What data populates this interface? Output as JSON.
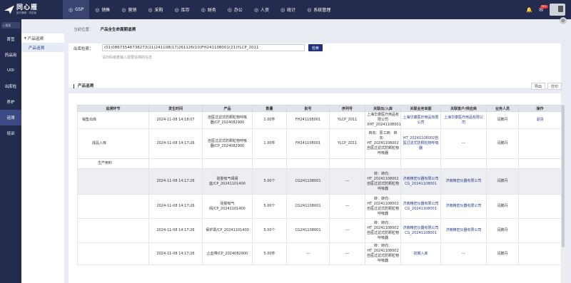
{
  "logo": {
    "title": "同心雁",
    "subtitle": "医疗器械 · 供应链"
  },
  "nav": [
    {
      "label": "GSP",
      "icon": "gsp-icon",
      "active": true
    },
    {
      "label": "销售",
      "icon": "sales-icon"
    },
    {
      "label": "营销",
      "icon": "marketing-icon"
    },
    {
      "label": "采购",
      "icon": "purchase-icon"
    },
    {
      "label": "库存",
      "icon": "inventory-icon"
    },
    {
      "label": "财务",
      "icon": "finance-icon"
    },
    {
      "label": "办公",
      "icon": "office-icon"
    },
    {
      "label": "人资",
      "icon": "hr-icon"
    },
    {
      "label": "统计",
      "icon": "stats-icon"
    },
    {
      "label": "系统管理",
      "icon": "system-icon"
    }
  ],
  "notification_badge": "99+",
  "sidebar": {
    "search_placeholder": "搜索",
    "items": [
      {
        "label": "首营"
      },
      {
        "label": "药品用"
      },
      {
        "label": "UDI"
      },
      {
        "label": "出库检"
      },
      {
        "label": "养护"
      },
      {
        "label": "追溯",
        "active": true
      },
      {
        "label": "培训"
      }
    ]
  },
  "subnav": {
    "header": "产品追溯",
    "item": "产品追溯"
  },
  "breadcrumb": {
    "prefix": "当前位置：",
    "current": "产品全生命周期追溯"
  },
  "scan": {
    "label": "出库检索：",
    "value": "(01)08673546738273(11)241108(17)261126(10)FH241108001(21)YLCP_2011",
    "button": "检索",
    "hint": "请扫码或者输入需要追溯的信息"
  },
  "trace": {
    "title": "产品追溯",
    "export": "导出",
    "print": "打印"
  },
  "columns": [
    "追溯环节",
    "发生时间",
    "产品",
    "数量",
    "批号",
    "序列号",
    "关联出/入库",
    "关联业务单据",
    "关联客户/供应商",
    "业务人员",
    "操作"
  ],
  "rows": [
    {
      "stage": "销售出库",
      "time": "2024-11-08 14:18:07",
      "product": "自医过滤式防颗粒物呼吸器/CP_2024082900",
      "qty": "1.00件",
      "batch": "FH241108001",
      "serial": "YLCP_2011",
      "io": "上海华康医疗用品有限公司 XHT_20241108001",
      "doc": "上海华康医疗用品有限公司",
      "partner": "上海华康医疗用品有限公司",
      "staff": "闫鹏丹",
      "action": "退货"
    },
    {
      "stage": "成品入库",
      "time": "2024-11-08 14:17:26",
      "product": "自医过滤式防颗粒物呼吸器/CP_2024082900",
      "qty": "1.00件",
      "batch": "FH241108001",
      "serial": "YLCP_2011",
      "io": "转向：原工转：转向：HT_20241108002自医过滤式防颗粒物呼吸器",
      "doc": "HT_20241108002自医过滤式防颗粒物呼吸器",
      "partner": "---",
      "staff": "闫鹏丹",
      "action": ""
    },
    {
      "stage": "生产用料",
      "time": "",
      "product": "",
      "qty": "",
      "batch": "",
      "serial": "",
      "io": "",
      "doc": "",
      "partner": "",
      "staff": "",
      "action": ""
    },
    {
      "stage": "",
      "time": "2024-11-08 14:17:26",
      "product": "硅胶吸气阀阀座/CP_20241101400",
      "qty": "5.00个",
      "batch": "CG241108001",
      "serial": "---",
      "io": "转：转向：HT_20241108002自医过滤式防颗粒物呼吸器",
      "doc": "济南精密仪器有限公司 CG_20241108001",
      "partner": "济南精密仪器有限公司",
      "staff": "闫鹏丹",
      "action": "",
      "shaded": true
    },
    {
      "stage": "",
      "time": "2024-11-08 14:17:26",
      "product": "硅胶吸气阀/CP_20241101400",
      "qty": "5.00个",
      "batch": "CG241108001",
      "serial": "---",
      "io": "转：转向：HT_20241108002自医过滤式防颗粒物呼吸器",
      "doc": "济南精密仪器有限公司 CG_20241108001",
      "partner": "济南精密仪器有限公司",
      "staff": "闫鹏丹",
      "action": ""
    },
    {
      "stage": "",
      "time": "2024-11-08 14:17:26",
      "product": "保护罩/CP_20241101400",
      "qty": "5.00个",
      "batch": "CG241108001",
      "serial": "---",
      "io": "转：转向：HT_20241108002自医过滤式防颗粒物呼吸器",
      "doc": "济南精密仪器有限公司 CG_20241108001",
      "partner": "济南精密仪器有限公司",
      "staff": "闫鹏丹",
      "action": ""
    },
    {
      "stage": "",
      "time": "2024-11-08 14:17:26",
      "product": "止血带/CP_2024082900",
      "qty": "5.00件",
      "batch": "---",
      "serial": "---",
      "io": "转：转向：HT_20241108002自医过滤式防颗粒物呼吸器",
      "doc": "初期入库",
      "partner": "---",
      "staff": "闫鹏丹",
      "action": ""
    }
  ]
}
